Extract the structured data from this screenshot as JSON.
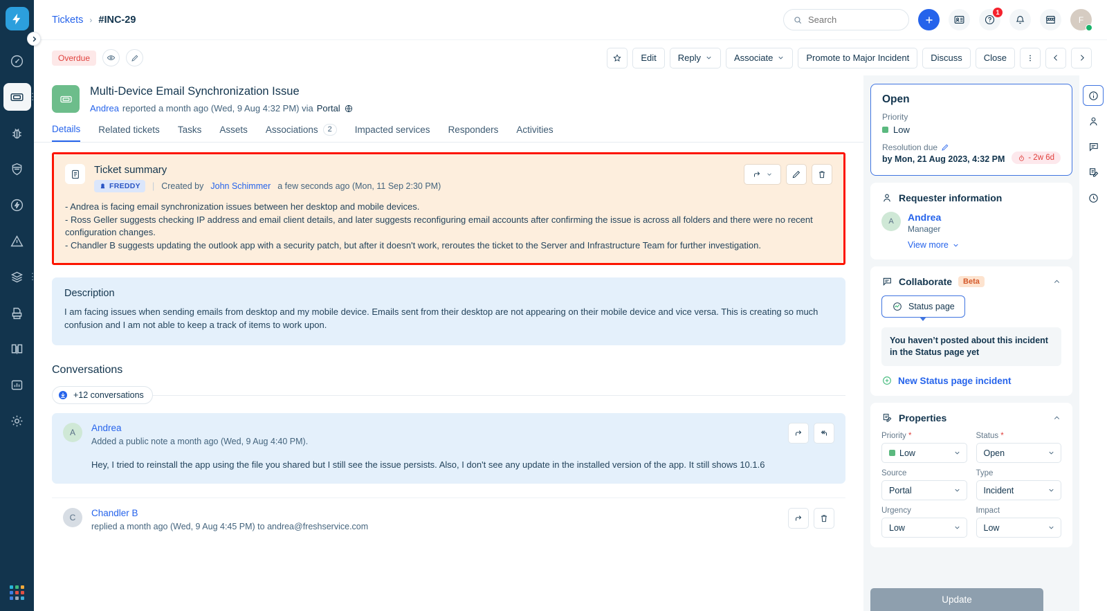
{
  "sidebar": {
    "logo": "freshservice-logo-icon",
    "items": [
      {
        "name": "dashboard",
        "icon": "gauge-icon"
      },
      {
        "name": "tickets",
        "icon": "ticket-icon",
        "active": true,
        "has_more": true
      },
      {
        "name": "problems",
        "icon": "bug-icon"
      },
      {
        "name": "changes",
        "icon": "shield-icon"
      },
      {
        "name": "releases",
        "icon": "bolt-circle-icon"
      },
      {
        "name": "alerts",
        "icon": "warning-triangle-icon"
      },
      {
        "name": "assets",
        "icon": "layers-icon",
        "has_more": true
      },
      {
        "name": "contracts",
        "icon": "printer-icon"
      },
      {
        "name": "solutions",
        "icon": "book-icon"
      },
      {
        "name": "analytics",
        "icon": "chart-icon"
      },
      {
        "name": "admin",
        "icon": "gear-icon"
      }
    ],
    "app_switcher": "app-grid-icon",
    "collapse_toggle": "chevron-right-icon"
  },
  "topbar": {
    "breadcrumb": {
      "root": "Tickets",
      "separator": "›",
      "current": "#INC-29"
    },
    "search": {
      "placeholder": "Search",
      "value": "",
      "icon": "search-icon"
    },
    "actions": [
      {
        "name": "new-button",
        "icon": "plus-icon"
      },
      {
        "name": "contacts-button",
        "icon": "contact-card-icon"
      },
      {
        "name": "help-button",
        "icon": "question-circle-icon",
        "badge": "1"
      },
      {
        "name": "notifications-button",
        "icon": "bell-icon"
      },
      {
        "name": "marketplace-button",
        "icon": "storefront-icon"
      }
    ],
    "avatar": {
      "initial": "F",
      "status": "online"
    }
  },
  "actionbar": {
    "status_pill": "Overdue",
    "watch_icon": "eye-icon",
    "edit_pencil_icon": "pencil-icon",
    "buttons": [
      {
        "name": "favorite-button",
        "label": "",
        "icon": "star-icon"
      },
      {
        "name": "edit-button",
        "label": "Edit"
      },
      {
        "name": "reply-button",
        "label": "Reply",
        "caret": true
      },
      {
        "name": "associate-button",
        "label": "Associate",
        "caret": true
      },
      {
        "name": "promote-major-incident-button",
        "label": "Promote to Major Incident"
      },
      {
        "name": "discuss-button",
        "label": "Discuss"
      },
      {
        "name": "close-button",
        "label": "Close"
      },
      {
        "name": "more-options-button",
        "label": "",
        "icon": "kebab-icon"
      },
      {
        "name": "previous-ticket-button",
        "label": "",
        "icon": "chevron-left-icon"
      },
      {
        "name": "next-ticket-button",
        "label": "",
        "icon": "chevron-right-icon"
      }
    ]
  },
  "ticket": {
    "title": "Multi-Device Email Synchronization Issue",
    "reporter": "Andrea",
    "reported_text": "reported a month ago (Wed, 9 Aug 4:32 PM) via",
    "channel": "Portal",
    "channel_icon": "globe-icon",
    "type_icon": "ticket-icon"
  },
  "tabs": [
    {
      "label": "Details",
      "active": true
    },
    {
      "label": "Related tickets"
    },
    {
      "label": "Tasks"
    },
    {
      "label": "Assets"
    },
    {
      "label": "Associations",
      "count": "2"
    },
    {
      "label": "Impacted services"
    },
    {
      "label": "Responders"
    },
    {
      "label": "Activities"
    }
  ],
  "summary": {
    "icon": "document-lines-icon",
    "title": "Ticket summary",
    "badge": "FREDDY",
    "badge_icon": "freddy-icon",
    "divider": "|",
    "created_prefix": "Created by",
    "author": "John Schimmer",
    "created_suffix": "a few seconds ago (Mon, 11 Sep 2:30 PM)",
    "bullets": [
      "- Andrea is facing email synchronization issues between her desktop and mobile devices.",
      "- Ross Geller suggests checking IP address and email client details, and later suggests reconfiguring email accounts after confirming the issue is across all folders and there were no recent configuration changes.",
      "- Chandler B suggests updating the outlook app with a security patch, but after it doesn't work, reroutes the ticket to the Server and Infrastructure Team for further investigation."
    ],
    "actions": [
      {
        "name": "share-summary-button",
        "icon": "share-arrow-icon",
        "caret": true
      },
      {
        "name": "edit-summary-button",
        "icon": "pencil-icon"
      },
      {
        "name": "delete-summary-button",
        "icon": "trash-icon"
      }
    ],
    "highlight_color": "#fc1500"
  },
  "description": {
    "heading": "Description",
    "text": "I am facing issues when sending emails from desktop and my mobile device. Emails sent from their desktop are not appearing on their mobile device and vice versa. This is creating so much confusion and I am not able to keep a track of items to work upon."
  },
  "conversations": {
    "heading": "Conversations",
    "collapsed_chip": "+12 conversations",
    "collapsed_icon": "download-circle-icon",
    "items": [
      {
        "avatar_initial": "A",
        "author": "Andrea",
        "meta": "Added a public note a month ago (Wed, 9 Aug 4:40 PM).",
        "message": "Hey, I tried to reinstall the app using the file you shared but I still see the issue persists. Also, I don't see any update in the installed version of the app. It still shows 10.1.6",
        "actions": [
          {
            "name": "forward-button",
            "icon": "share-arrow-icon"
          },
          {
            "name": "reply-all-button",
            "icon": "reply-all-icon"
          }
        ]
      },
      {
        "avatar_initial": "C",
        "author": "Chandler B",
        "meta": "replied a month ago (Wed, 9 Aug 4:45 PM) to andrea@freshservice.com",
        "message": "",
        "actions": [
          {
            "name": "forward-button",
            "icon": "share-arrow-icon"
          },
          {
            "name": "delete-button",
            "icon": "trash-icon"
          }
        ]
      }
    ]
  },
  "right_panel": {
    "status_card": {
      "status": "Open",
      "priority_label": "Priority",
      "priority_value": "Low",
      "priority_color": "#5bb97f",
      "resolution_label": "Resolution due",
      "resolution_edit_icon": "pencil-icon",
      "resolution_value": "by Mon, 21 Aug 2023, 4:32 PM",
      "sla_badge": "- 2w 6d",
      "sla_icon": "stopwatch-icon"
    },
    "requester": {
      "heading": "Requester information",
      "heading_icon": "person-icon",
      "avatar_initial": "A",
      "name": "Andrea",
      "role": "Manager",
      "view_more": "View more",
      "view_more_icon": "chevron-down-icon"
    },
    "collaborate": {
      "heading": "Collaborate",
      "heading_icon": "chat-icon",
      "badge": "Beta",
      "collapse_icon": "chevron-up-icon",
      "status_page_button": "Status page",
      "status_page_icon": "statuspage-graph-icon",
      "note": "You haven’t posted about this incident in the Status page yet",
      "new_incident": "New Status page incident",
      "new_incident_icon": "plus-circle-icon"
    },
    "properties": {
      "heading": "Properties",
      "heading_icon": "clipboard-edit-icon",
      "collapse_icon": "chevron-up-icon",
      "fields": [
        {
          "label": "Priority",
          "required": true,
          "value": "Low",
          "swatch": "#5bb97f"
        },
        {
          "label": "Status",
          "required": true,
          "value": "Open"
        },
        {
          "label": "Source",
          "required": false,
          "value": "Portal"
        },
        {
          "label": "Type",
          "required": false,
          "value": "Incident"
        },
        {
          "label": "Urgency",
          "required": false,
          "value": "Low"
        },
        {
          "label": "Impact",
          "required": false,
          "value": "Low"
        }
      ]
    },
    "update_button": "Update",
    "rail": [
      {
        "name": "details-tab",
        "icon": "info-circle-icon",
        "active": true
      },
      {
        "name": "requester-tab",
        "icon": "person-icon"
      },
      {
        "name": "collaborate-tab",
        "icon": "chat-icon"
      },
      {
        "name": "properties-tab",
        "icon": "clipboard-edit-icon"
      },
      {
        "name": "activity-tab",
        "icon": "clock-icon"
      }
    ]
  }
}
